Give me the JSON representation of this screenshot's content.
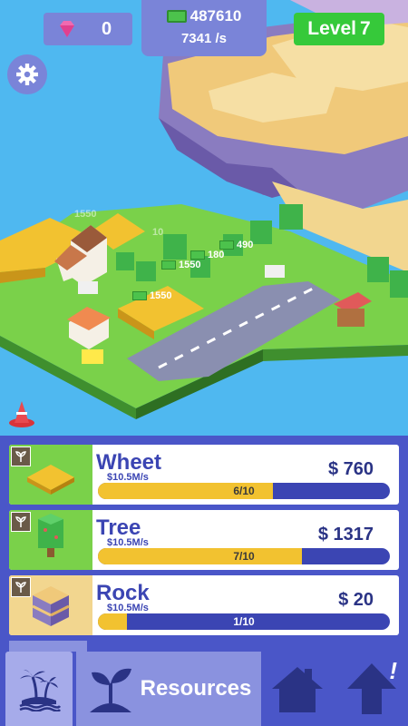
{
  "hud": {
    "gems": "0",
    "money": "487610",
    "rate": "7341 /s",
    "level_label": "Level",
    "level_value": "7"
  },
  "floating_income": [
    "1550",
    "10",
    "1550",
    "180",
    "490",
    "1550"
  ],
  "resources": [
    {
      "name": "Wheet",
      "rate": "$10.5M/s",
      "price": "$ 760",
      "progress_text": "6/10",
      "progress": 0.6
    },
    {
      "name": "Tree",
      "rate": "$10.5M/s",
      "price": "$ 1317",
      "progress_text": "7/10",
      "progress": 0.7
    },
    {
      "name": "Rock",
      "rate": "$10.5M/s",
      "price": "$ 20",
      "progress_text": "1/10",
      "progress": 0.1
    }
  ],
  "nav": {
    "resources_label": "Resources",
    "alert": "!"
  },
  "colors": {
    "sky_water": "#4fb8f0",
    "panel": "#4a56c8",
    "progress_fill": "#f2c230",
    "level_badge": "#36c93a"
  }
}
